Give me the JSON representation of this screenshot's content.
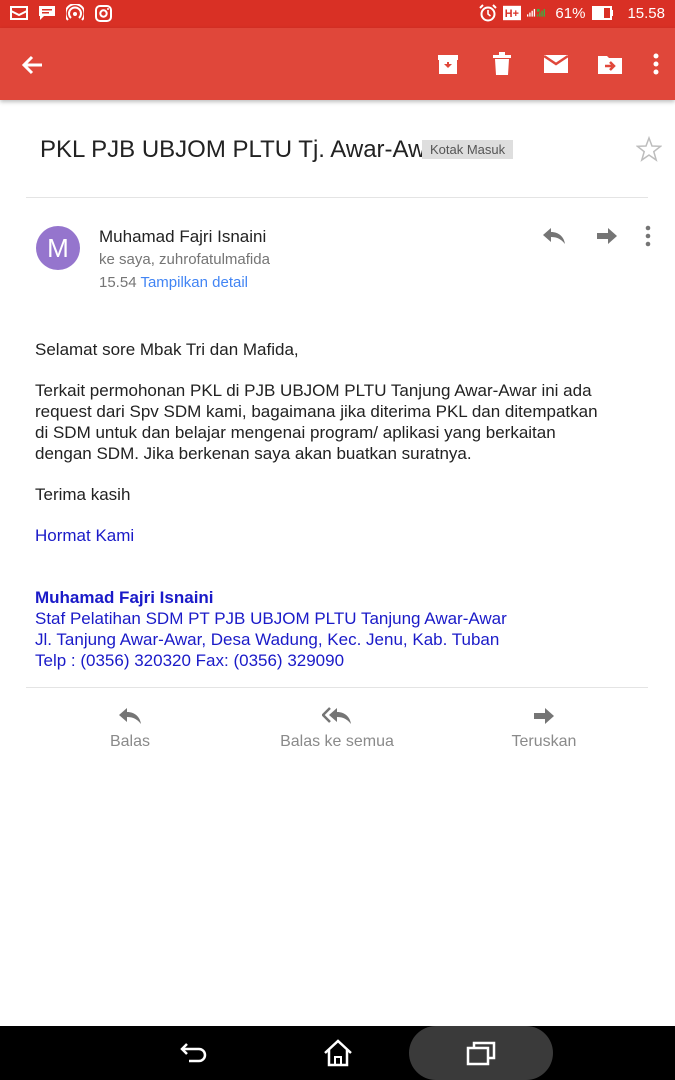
{
  "status_bar": {
    "battery": "61%",
    "time": "15.58",
    "icons": [
      "mail-icon",
      "chat-icon",
      "hotspot-icon",
      "instagram-icon",
      "alarm-icon",
      "hplus-icon",
      "signal-icon",
      "battery-icon"
    ]
  },
  "toolbar": {
    "back_icon": "arrow-left-icon",
    "actions": [
      "archive-icon",
      "delete-icon",
      "mark-unread-icon",
      "move-icon",
      "more-vert-icon"
    ]
  },
  "email": {
    "subject": "PKL PJB UBJOM PLTU Tj. Awar-Awar",
    "label": "Kotak Masuk",
    "avatar_letter": "M",
    "sender": "Muhamad Fajri Isnaini",
    "recipients": "ke saya, zuhrofatulmafida",
    "time": "15.54",
    "details_link": "Tampilkan detail",
    "greeting": "Selamat sore Mbak Tri dan Mafida,",
    "paragraph_lines": [
      "Terkait permohonan PKL di PJB UBJOM PLTU Tanjung Awar-Awar ini ada",
      "request dari Spv SDM kami, bagaimana jika diterima PKL dan ditempatkan",
      "di SDM untuk dan belajar mengenai program/ aplikasi yang berkaitan",
      "dengan SDM. Jika berkenan saya akan buatkan suratnya."
    ],
    "thanks": "Terima kasih",
    "closing": "Hormat Kami",
    "signature": {
      "name": "Muhamad Fajri Isnaini",
      "title": "Staf Pelatihan SDM PT PJB UBJOM PLTU Tanjung Awar-Awar",
      "address": "Jl. Tanjung Awar-Awar, Desa Wadung, Kec. Jenu, Kab. Tuban",
      "phone": "Telp : (0356) 320320  Fax: (0356) 329090"
    }
  },
  "bottom_actions": {
    "reply": "Balas",
    "reply_all": "Balas ke semua",
    "forward": "Teruskan"
  },
  "colors": {
    "status_bar": "#d93025",
    "app_bar": "#e0473a",
    "avatar": "#9575cd",
    "link": "#4285f4",
    "signature_blue": "#1a1ac8"
  }
}
